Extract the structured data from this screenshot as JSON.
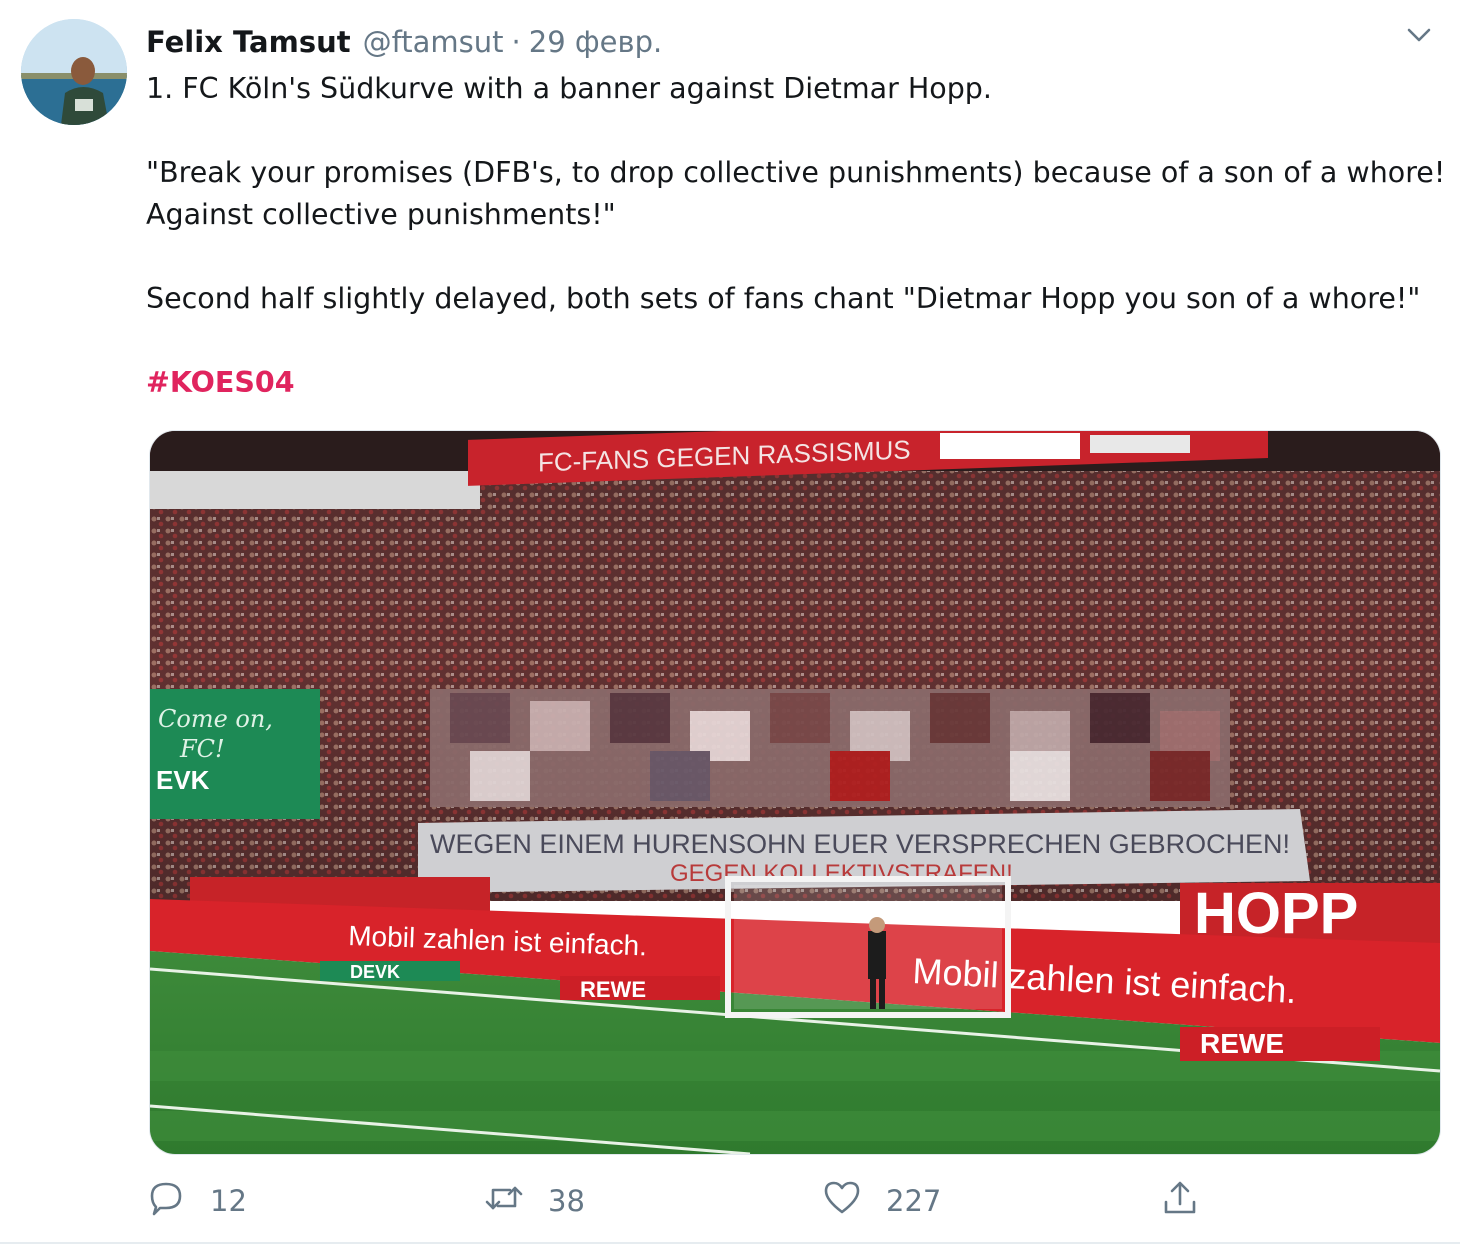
{
  "tweet": {
    "author_name": "Felix Tamsut",
    "handle": "@ftamsut",
    "separator": "·",
    "date": "29 февр.",
    "text_lines": [
      "1. FC Köln's Südkurve with a banner against Dietmar Hopp.",
      "\"Break your promises (DFB's, to drop collective punishments) because of a son of a whore!",
      "Against collective punishments!\"",
      "Second half slightly delayed, both sets of fans chant \"Dietmar Hopp you son of a whore!\""
    ],
    "hashtag": "#KOES04",
    "hashtag_color": "#e0245e"
  },
  "media": {
    "photo_texts": {
      "top_banner": "FC-FANS GEGEN RASSISMUS",
      "green_board_line1": "Come on,",
      "green_board_line2": "FC!",
      "green_board_line3": "EVK",
      "fan_banner": "WEGEN EINEM HURENSOHN EUER VERSPRECHEN GEBROCHEN!",
      "fan_banner_line2": "GEGEN KOLLEKTIVSTRAFEN!",
      "ad_mobil": "Mobil zahlen ist einfach.",
      "ad_rewe": "REWE",
      "ad_devk": "DEVK",
      "ad_right": "HOPP"
    }
  },
  "actions": {
    "reply_count": "12",
    "retweet_count": "38",
    "like_count": "227"
  },
  "icons": [
    "avatar",
    "chevron-down-icon",
    "reply-icon",
    "retweet-icon",
    "like-icon",
    "share-icon"
  ],
  "colors": {
    "text": "#14171a",
    "secondary": "#657786",
    "accent": "#e0245e"
  }
}
